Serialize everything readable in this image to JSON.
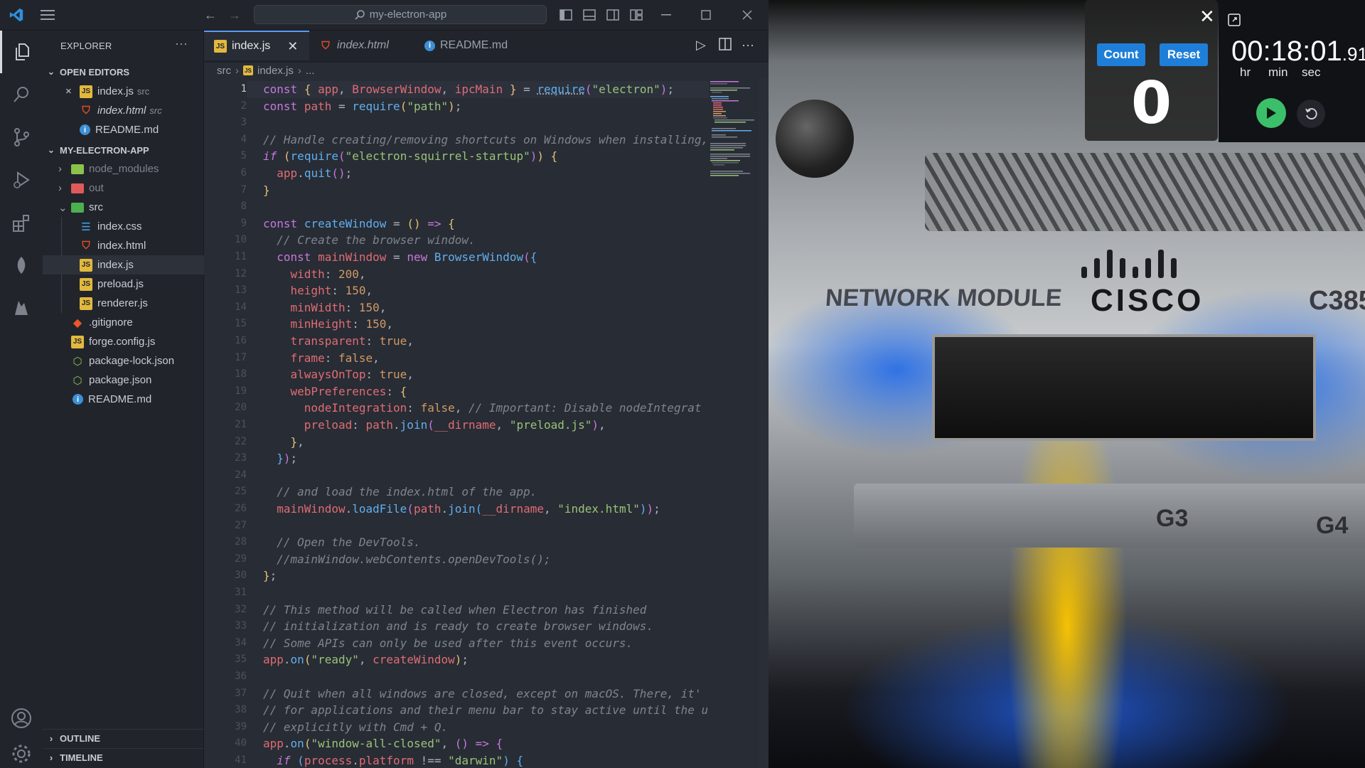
{
  "titlebar": {
    "search_text": "my-electron-app"
  },
  "sidebar": {
    "title": "EXPLORER",
    "open_editors_header": "OPEN EDITORS",
    "open_editors": [
      {
        "name": "index.js",
        "hint": "src",
        "type": "js",
        "close": "×"
      },
      {
        "name": "index.html",
        "hint": "src",
        "type": "html"
      },
      {
        "name": "README.md",
        "hint": "",
        "type": "info"
      }
    ],
    "project_header": "MY-ELECTRON-APP",
    "tree": [
      {
        "name": "node_modules",
        "type": "folder-green"
      },
      {
        "name": "out",
        "type": "folder-red"
      },
      {
        "name": "src",
        "type": "folder-open"
      },
      {
        "name": "index.css",
        "type": "css"
      },
      {
        "name": "index.html",
        "type": "html"
      },
      {
        "name": "index.js",
        "type": "js"
      },
      {
        "name": "preload.js",
        "type": "js"
      },
      {
        "name": "renderer.js",
        "type": "js"
      },
      {
        "name": ".gitignore",
        "type": "git"
      },
      {
        "name": "forge.config.js",
        "type": "js"
      },
      {
        "name": "package-lock.json",
        "type": "json"
      },
      {
        "name": "package.json",
        "type": "json"
      },
      {
        "name": "README.md",
        "type": "info"
      }
    ],
    "outline_header": "OUTLINE",
    "timeline_header": "TIMELINE"
  },
  "tabs": [
    {
      "label": "index.js",
      "active": true
    },
    {
      "label": "index.html",
      "active": false
    },
    {
      "label": "README.md",
      "active": false
    }
  ],
  "breadcrumb": {
    "folder": "src",
    "file": "index.js",
    "rest": "..."
  },
  "editor": {
    "current_line": 1,
    "line_numbers": [
      "1",
      "2",
      "3",
      "4",
      "5",
      "6",
      "7",
      "8",
      "9",
      "10",
      "11",
      "12",
      "13",
      "14",
      "15",
      "16",
      "17",
      "18",
      "19",
      "20",
      "21",
      "22",
      "23",
      "24",
      "25",
      "26",
      "27",
      "28",
      "29",
      "30",
      "31",
      "32",
      "33",
      "34",
      "35",
      "36",
      "37",
      "38",
      "39",
      "40",
      "41"
    ]
  },
  "counter": {
    "count_label": "Count",
    "reset_label": "Reset",
    "value": "0",
    "close": "✕"
  },
  "stopwatch": {
    "hours": "00",
    "minutes": "18",
    "seconds": "01",
    "hundredths": "91",
    "hr_label": "hr",
    "min_label": "min",
    "sec_label": "sec"
  },
  "photo": {
    "module_text": "NETWORK MODULE",
    "brand_text": "CISCO",
    "model_text": "C385",
    "port_g3": "G3",
    "port_g4": "G4"
  },
  "colors": {
    "accent": "#5c9cf5",
    "counter_button": "#1f7fd8",
    "play_button": "#3cbf6a"
  }
}
